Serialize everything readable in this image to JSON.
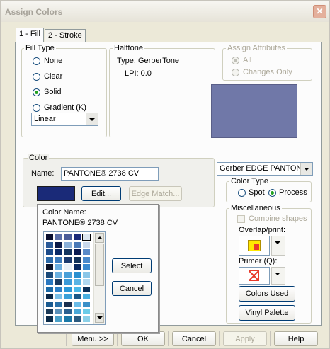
{
  "dialog": {
    "title": "Assign Colors",
    "close_glyph": "✕"
  },
  "tabs": [
    {
      "label": "1 - Fill"
    },
    {
      "label": "2 - Stroke"
    }
  ],
  "fill_type": {
    "legend": "Fill Type",
    "options": [
      "None",
      "Clear",
      "Solid",
      "Gradient (K)"
    ],
    "selected": "Solid",
    "gradient_value": "Linear"
  },
  "halftone": {
    "legend": "Halftone",
    "type_text": "Type: GerberTone",
    "lpi_text": "LPI: 0.0"
  },
  "assign_attributes": {
    "legend": "Assign Attributes",
    "options": [
      "All",
      "Changes Only"
    ]
  },
  "color": {
    "legend": "Color",
    "name_label": "Name:",
    "name_value": "PANTONE® 2738 CV",
    "swatch_color": "#1a2a78",
    "edit_button": "Edit...",
    "edge_match_button": "Edge Match...",
    "preview_color": "#7078a8"
  },
  "palette_popup": {
    "color_name_label": "Color Name:",
    "color_name_value": "PANTONE® 2738 CV",
    "select_button": "Select",
    "cancel_button": "Cancel",
    "rows": [
      [
        "#0a1030",
        "#5a6ea8",
        "#4a5c98",
        "#1a2a78",
        "#dce6f0"
      ],
      [
        "#2a5a98",
        "#0a1a48",
        "#8ab0d8",
        "#4a7ab8",
        "#c8d8ec"
      ],
      [
        "#1a4a8a",
        "#0a2a68",
        "#12345e",
        "#0a1a50",
        "#5a8ac8"
      ],
      [
        "#2a6aaa",
        "#3a7abb",
        "#1a3a70",
        "#103058",
        "#4a8acc"
      ],
      [
        "#0a1228",
        "#6aaee0",
        "#e8f0f8",
        "#082860",
        "#3a8ad0"
      ],
      [
        "#1a4a7a",
        "#6ab0e0",
        "#4aa0d8",
        "#2a90d0",
        "#8ac6e8"
      ],
      [
        "#2a78c0",
        "#1a3a60",
        "#3a9ad8",
        "#5ab4e4",
        "#b0d8f0"
      ],
      [
        "#1a6aa8",
        "#2a80c8",
        "#2a98d8",
        "#4ab8e8",
        "#0a3058"
      ],
      [
        "#0a2848",
        "#7ac0e8",
        "#3aa0d8",
        "#1a5888",
        "#4ab0e0"
      ],
      [
        "#1a5a90",
        "#2a70a8",
        "#1a3050",
        "#6abce8",
        "#3a90c8"
      ],
      [
        "#1a3a58",
        "#5a90b8",
        "#2a6090",
        "#4aa8d8",
        "#6acce8"
      ],
      [
        "#0a2a48",
        "#4aa0c8",
        "#1a78a8",
        "#2a5a80",
        "#8ad0e8"
      ]
    ],
    "selected_cell": [
      0,
      4
    ]
  },
  "library": {
    "value": "Gerber EDGE PANTONE® F"
  },
  "color_type": {
    "legend": "Color Type",
    "options": [
      "Spot",
      "Process"
    ],
    "selected": "Process"
  },
  "miscellaneous": {
    "legend": "Miscellaneous",
    "combine_label": "Combine shapes",
    "overlap_label": "Overlap/print:",
    "primer_label": "Primer (Q):",
    "colors_used_button": "Colors Used",
    "vinyl_palette_button": "Vinyl Palette",
    "overlap_icon_colors": [
      "#ffe800",
      "#e83a2a"
    ],
    "primer_icon_color": "#e83a2a"
  },
  "bottom": {
    "menu_button": "Menu >>",
    "ok_button": "OK",
    "cancel_button": "Cancel",
    "apply_button": "Apply",
    "help_button": "Help"
  }
}
